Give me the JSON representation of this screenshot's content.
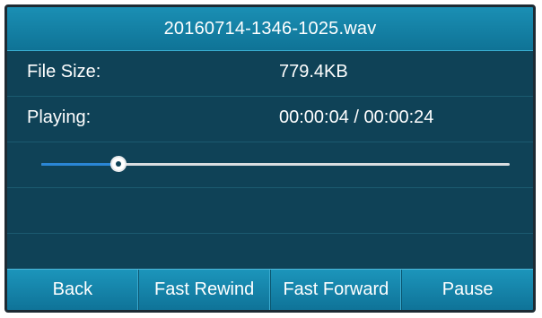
{
  "title": "20160714-1346-1025.wav",
  "file_size": {
    "label": "File Size:",
    "value": "779.4KB"
  },
  "playing": {
    "label": "Playing:",
    "value": "00:00:04 / 00:00:24",
    "progress": 0.165
  },
  "softkeys": {
    "back": "Back",
    "fast_rewind": "Fast Rewind",
    "fast_forward": "Fast Forward",
    "pause": "Pause"
  },
  "colors": {
    "background": "#0f4257",
    "bar": "#1183a8",
    "progress_fill": "#2a86d6",
    "progress_track": "#d9dde0"
  }
}
